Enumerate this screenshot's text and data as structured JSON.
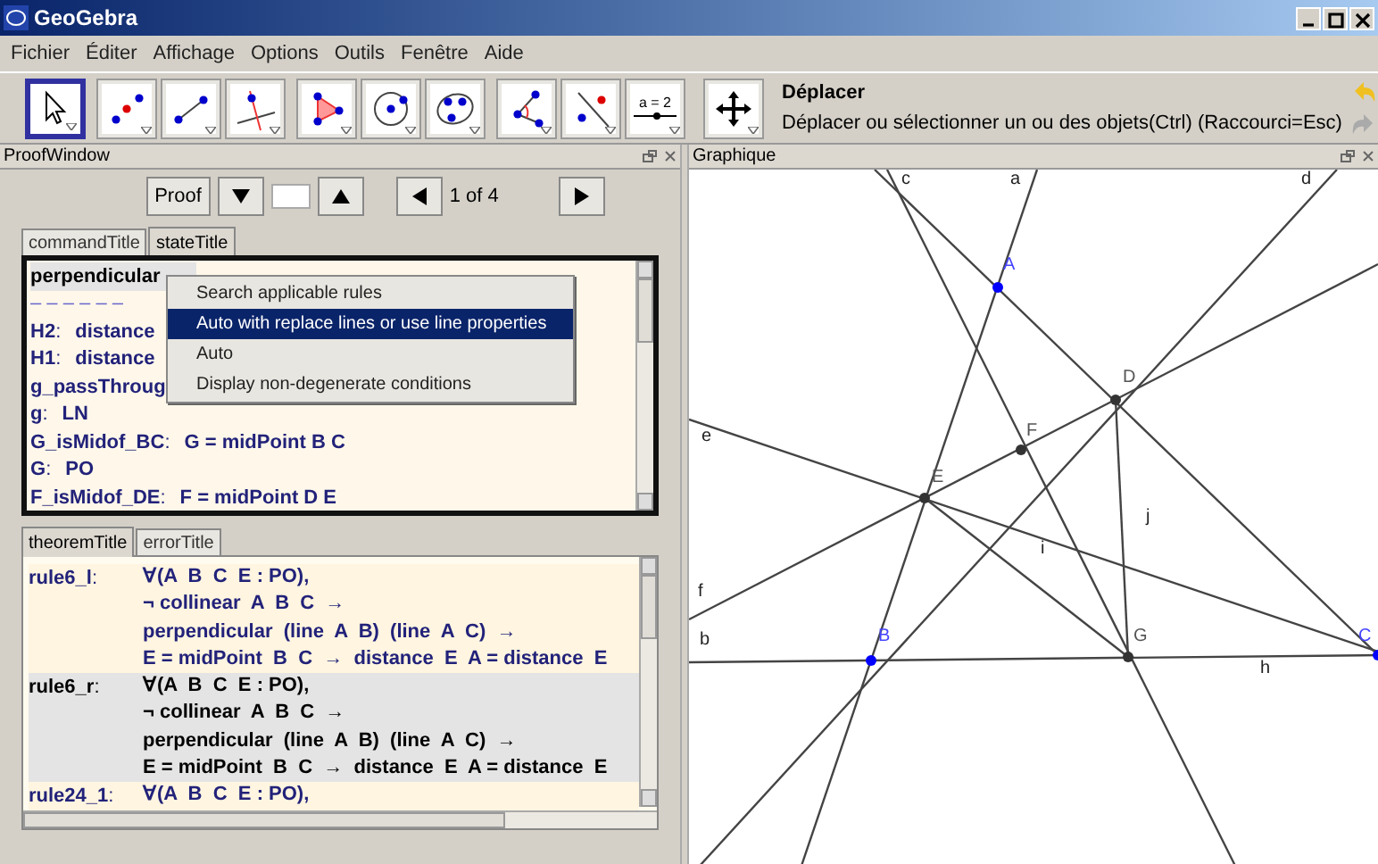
{
  "window": {
    "title": "GeoGebra"
  },
  "menu": [
    "Fichier",
    "Éditer",
    "Affichage",
    "Options",
    "Outils",
    "Fenêtre",
    "Aide"
  ],
  "tools": [
    {
      "kind": "move",
      "selected": true
    },
    {
      "kind": "point",
      "selected": false
    },
    {
      "kind": "segment",
      "selected": false
    },
    {
      "kind": "perpendicular",
      "selected": false
    },
    {
      "kind": "polygon",
      "selected": false
    },
    {
      "kind": "circle",
      "selected": false
    },
    {
      "kind": "conic",
      "selected": false
    },
    {
      "kind": "angle",
      "selected": false
    },
    {
      "kind": "reflect",
      "selected": false
    },
    {
      "kind": "slider",
      "selected": false,
      "label": "a = 2"
    }
  ],
  "current_tool": {
    "kind": "move",
    "name": "Déplacer",
    "description": "Déplacer ou sélectionner un ou des objets(Ctrl) (Raccourci=Esc)"
  },
  "proof_window": {
    "title": "ProofWindow",
    "nav": {
      "proof_button": "Proof",
      "page": "1 of 4"
    },
    "state_tabs": [
      {
        "label": "commandTitle",
        "selected": false
      },
      {
        "label": "stateTitle",
        "selected": true
      }
    ],
    "state_rows": [
      {
        "label": "perpendicular",
        "value": "",
        "selected": true
      },
      {
        "label": "– – – – – –",
        "value": "",
        "selected": false
      },
      {
        "label": "H2",
        "sep": ":",
        "value": "distance",
        "selected": false
      },
      {
        "label": "H1",
        "sep": ":",
        "value": "distance",
        "selected": false
      },
      {
        "label": "g_passThroug",
        "value": "",
        "selected": false
      },
      {
        "label": "g",
        "sep": ":",
        "value": "LN",
        "selected": false
      },
      {
        "label": "G_isMidof_BC",
        "sep": ":",
        "value": "G = midPoint  B  C",
        "selected": false
      },
      {
        "label": "G",
        "sep": ":",
        "value": "PO",
        "selected": false
      },
      {
        "label": "F_isMidof_DE",
        "sep": ":",
        "value": "F = midPoint  D  E",
        "selected": false
      }
    ],
    "context_menu": [
      {
        "label": "Search applicable rules",
        "selected": false
      },
      {
        "label": "Auto with replace lines or use line properties",
        "selected": true
      },
      {
        "label": "Auto",
        "selected": false
      },
      {
        "label": "Display non-degenerate conditions",
        "selected": false
      }
    ],
    "theorem_tabs": [
      {
        "label": "theoremTitle",
        "selected": true
      },
      {
        "label": "errorTitle",
        "selected": false
      }
    ],
    "theorems": [
      {
        "name": "rule6_l",
        "sep": ":",
        "selected": false,
        "lines": [
          "∀(A  B  C  E : PO),",
          "¬ collinear  A  B  C  →",
          "perpendicular  (line  A  B)  (line  A  C)  →",
          "E = midPoint  B  C  →  distance  E  A = distance  E"
        ]
      },
      {
        "name": "rule6_r",
        "sep": ":",
        "selected": true,
        "lines": [
          "∀(A  B  C  E : PO),",
          "¬ collinear  A  B  C  →",
          "perpendicular  (line  A  B)  (line  A  C)  →",
          "E = midPoint  B  C  →  distance  E  A = distance  E"
        ]
      },
      {
        "name": "rule24_1",
        "sep": ":",
        "selected": false,
        "lines": [
          "∀(A  B  C  E : PO),"
        ]
      }
    ]
  },
  "graphics": {
    "title": "Graphique",
    "points": [
      {
        "name": "A",
        "color": "#0000ff"
      },
      {
        "name": "D",
        "color": "#333333"
      },
      {
        "name": "F",
        "color": "#333333"
      },
      {
        "name": "E",
        "color": "#333333"
      },
      {
        "name": "B",
        "color": "#0000ff"
      },
      {
        "name": "G",
        "color": "#333333"
      },
      {
        "name": "C",
        "color": "#0000ff"
      }
    ],
    "line_labels": [
      "c",
      "a",
      "d",
      "e",
      "f",
      "b",
      "j",
      "i",
      "h"
    ]
  }
}
